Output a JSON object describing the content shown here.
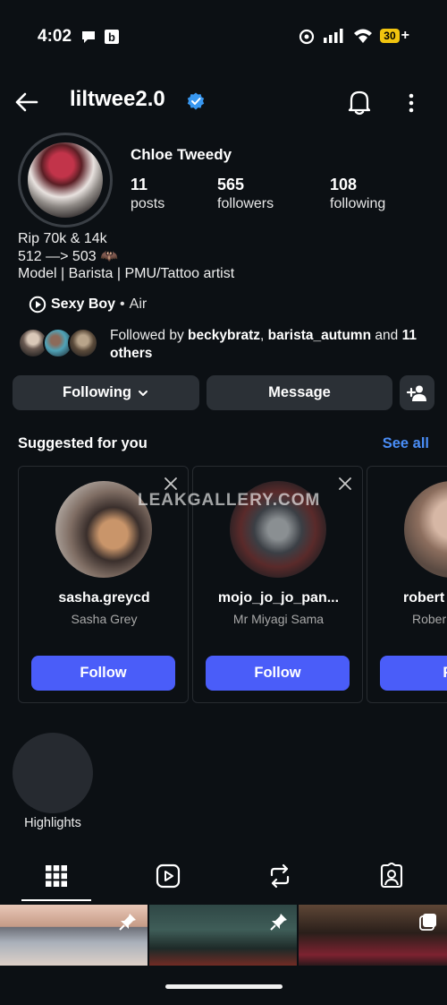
{
  "status_bar": {
    "time": "4:02",
    "battery": "30",
    "battery_plus": "+",
    "left_icons": [
      "chat-bubble-icon",
      "b-app-icon"
    ],
    "right_icons": [
      "alarm-icon",
      "signal-icon",
      "wifi-icon",
      "battery-icon"
    ]
  },
  "header": {
    "username": "liltwee2.0",
    "verified_color": "#3897f0"
  },
  "profile": {
    "display_name": "Chloe Tweedy",
    "stats": [
      {
        "value": "11",
        "label": "posts"
      },
      {
        "value": "565",
        "label": "followers"
      },
      {
        "value": "108",
        "label": "following"
      }
    ],
    "bio_lines": [
      "Rip 70k & 14k",
      "512 —> 503 🦇",
      "Model | Barista | PMU/Tattoo artist"
    ],
    "music": {
      "title": "Sexy Boy",
      "separator": "•",
      "artist": "Air"
    },
    "followed_by": {
      "prefix": "Followed by",
      "user1": "beckybratz",
      "sep1": ",",
      "user2": "barista_autumn",
      "conj": "and",
      "others": "11 others"
    }
  },
  "actions": {
    "following_label": "Following",
    "message_label": "Message"
  },
  "suggested": {
    "title": "Suggested for you",
    "see_all": "See all",
    "cards": [
      {
        "username": "sasha.greycd",
        "name": "Sasha Grey",
        "follow": "Follow"
      },
      {
        "username": "mojo_jo_jo_pan...",
        "name": "Mr Miyagi Sama",
        "follow": "Follow"
      },
      {
        "username": "robert",
        "name": "Rober",
        "follow": "Fo"
      }
    ]
  },
  "watermark": "LEAKGALLERY.COM",
  "highlights": {
    "label": "Highlights"
  },
  "tabs": [
    "grid-icon",
    "reels-icon",
    "reposts-icon",
    "tagged-icon"
  ],
  "colors": {
    "background": "#0c1014",
    "button": "#2b3036",
    "follow_button": "#4a5df9",
    "link": "#4a8ef8"
  }
}
